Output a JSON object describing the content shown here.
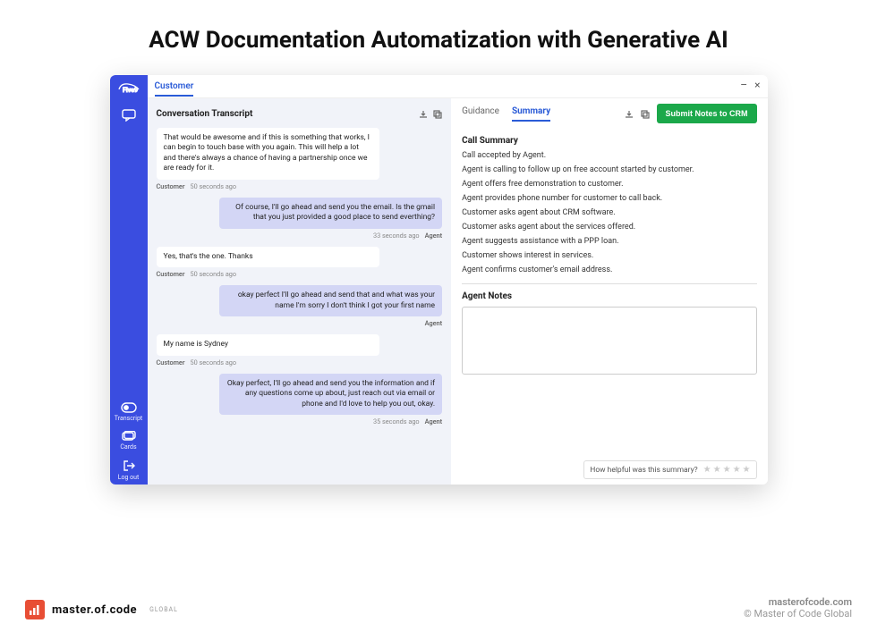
{
  "page": {
    "title": "ACW Documentation Automatization with Generative AI"
  },
  "sidebar": {
    "logo_text": "Five9",
    "top_icon": "chat-icon",
    "items": [
      {
        "icon": "transcript-icon",
        "label": "Transcript"
      },
      {
        "icon": "cards-icon",
        "label": "Cards"
      },
      {
        "icon": "logout-icon",
        "label": "Log out"
      }
    ]
  },
  "topbar": {
    "tab": "Customer",
    "minimize": "–",
    "close": "×"
  },
  "transcript": {
    "title": "Conversation Transcript",
    "messages": [
      {
        "role": "customer",
        "text": "That would be awesome and if this is something that works, I can begin to touch base with you again. This will help a lot and there's always a chance of having a partnership once we are ready for it.",
        "who": "Customer",
        "time": "50 seconds ago"
      },
      {
        "role": "agent",
        "text": "Of course, I'll go ahead and send you the email. Is the gmail that you just provided a good place to send everthing?",
        "who": "Agent",
        "time": "33 seconds ago"
      },
      {
        "role": "customer",
        "text": "Yes, that's the one. Thanks",
        "who": "Customer",
        "time": "50 seconds ago"
      },
      {
        "role": "agent",
        "text": "okay perfect I'll go ahead and send that and what was your name I'm sorry I don't think I got your first name",
        "who": "Agent",
        "time": ""
      },
      {
        "role": "customer",
        "text": "My name is Sydney",
        "who": "Customer",
        "time": "50 seconds ago"
      },
      {
        "role": "agent",
        "text": "Okay perfect, I'll go ahead and send you the information and if any questions come up about, just reach out via email or phone and I'd love to help you out, okay.",
        "who": "Agent",
        "time": "35 seconds ago"
      }
    ]
  },
  "summary": {
    "tabs": {
      "guidance": "Guidance",
      "summary": "Summary"
    },
    "submit_label": "Submit Notes to CRM",
    "call_summary_title": "Call Summary",
    "lines": [
      "Call accepted by Agent.",
      "Agent is calling to follow up on free account started by customer.",
      "Agent offers free demonstration to customer.",
      "Agent provides phone number for customer to call back.",
      "Customer asks agent about CRM software.",
      "Customer asks agent about the services offered.",
      "Agent suggests assistance with a PPP loan.",
      "Customer shows interest in services.",
      "Agent confirms customer's email address."
    ],
    "agent_notes_title": "Agent Notes",
    "feedback_prompt": "How helpful was this summary?"
  },
  "footer": {
    "brand_name": "master.of.code",
    "brand_sub": "GLOBAL",
    "url": "masterofcode.com",
    "copyright": "© Master of Code Global"
  }
}
